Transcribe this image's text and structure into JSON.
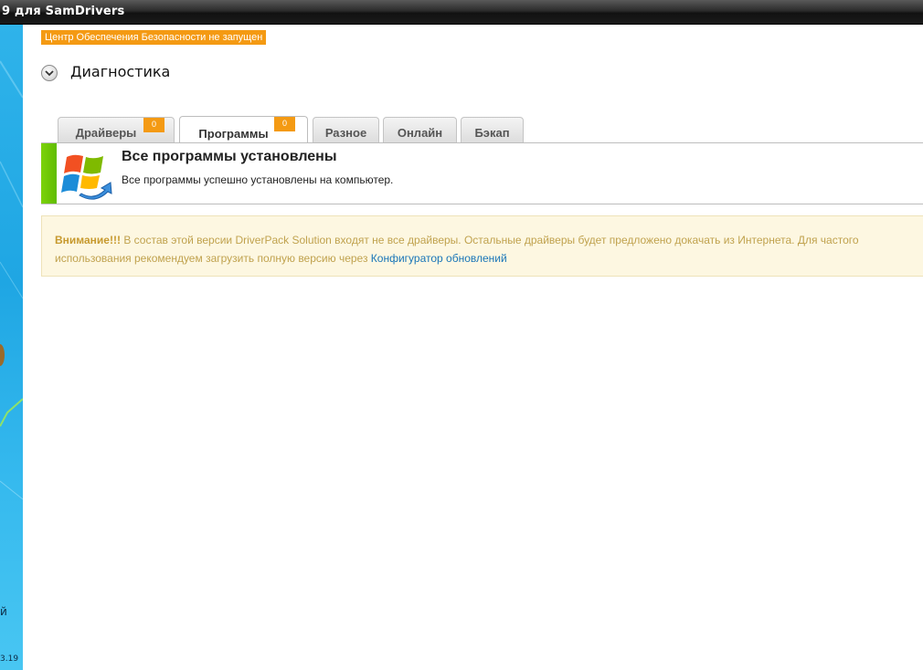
{
  "window": {
    "title": "9 для SamDrivers"
  },
  "desktop": {
    "side_text_1": "й",
    "side_text_2": "3.19"
  },
  "header": {
    "security_warning": "Центр Обеспечения Безопасности не запущен",
    "section_title": "Диагностика"
  },
  "tabs": [
    {
      "label": "Драйверы",
      "badge": "0",
      "active": false
    },
    {
      "label": "Программы",
      "badge": "0",
      "active": true
    },
    {
      "label": "Разное",
      "active": false
    },
    {
      "label": "Онлайн",
      "active": false
    },
    {
      "label": "Бэкап",
      "active": false
    }
  ],
  "status": {
    "title": "Все программы установлены",
    "description": "Все программы успешно установлены на компьютер.",
    "accent_color": "#66c000",
    "icon": "windows-update-icon"
  },
  "warning": {
    "strong": "Внимание!!!",
    "line1_text": " В состав этой версии DriverPack Solution входят не все драйверы. Остальные драйверы будет предложено докачать из Интернета. Для частого",
    "line2_text": "использования рекомендуем загрузить полную версию через ",
    "link_text": "Конфигуратор обновлений"
  },
  "colors": {
    "badge": "#f49a13",
    "link": "#1a76b8",
    "warning_text": "#c0a24e",
    "warning_bg": "#fdf7e1"
  }
}
